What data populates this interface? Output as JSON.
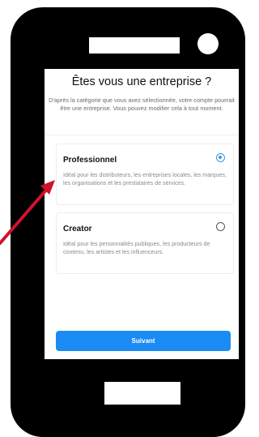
{
  "screen": {
    "title": "Êtes vous une entreprise ?",
    "subtitle": "D'après la catégorie que vous avez sélectionnée, votre compte pourrait être une entreprise. Vous pouvez modifier cela à tout moment.",
    "options": [
      {
        "title": "Professionnel",
        "description": "Idéal pour les distributeurs, les entreprises locales, les marques, les organisations et les prestataires de services.",
        "selected": true
      },
      {
        "title": "Creator",
        "description": "Idéal pour les personnalités publiques, les producteurs de contenu, les artistes et les influenceurs.",
        "selected": false
      }
    ],
    "next_label": "Suivant"
  },
  "colors": {
    "accent": "#1a8cf3",
    "arrow": "#d0122c",
    "phone_body": "#000000"
  },
  "icons": {
    "radio_selected": "radio-selected-icon",
    "radio_unselected": "radio-unselected-icon",
    "annotation_arrow": "red-arrow"
  }
}
